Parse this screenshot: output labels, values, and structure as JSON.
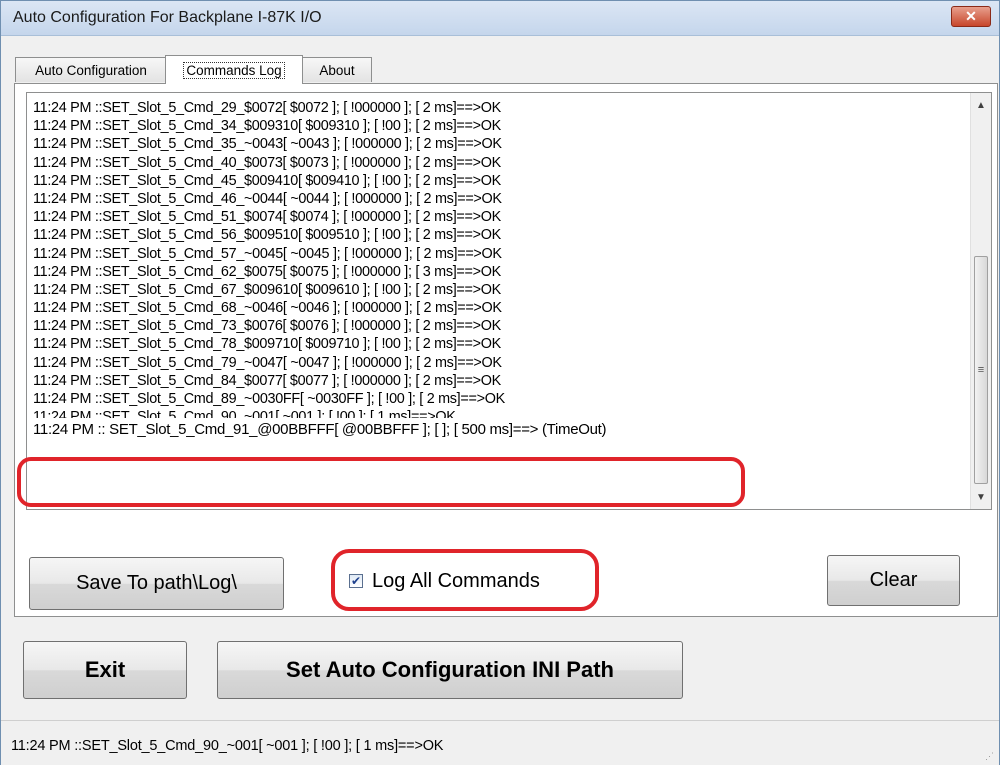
{
  "window": {
    "title": "Auto Configuration For Backplane I-87K I/O",
    "close_label": "✕"
  },
  "tabs": [
    {
      "label": "Auto Configuration",
      "active": false
    },
    {
      "label": "Commands Log",
      "active": true
    },
    {
      "label": "About",
      "active": false
    }
  ],
  "log": {
    "lines": [
      "11:24 PM ::SET_Slot_5_Cmd_29_$0072[ $0072 ]; [ !000000 ]; [ 2 ms]==>OK",
      "11:24 PM ::SET_Slot_5_Cmd_34_$009310[ $009310 ]; [ !00 ]; [ 2 ms]==>OK",
      "11:24 PM ::SET_Slot_5_Cmd_35_~0043[ ~0043 ]; [ !000000 ]; [ 2 ms]==>OK",
      "11:24 PM ::SET_Slot_5_Cmd_40_$0073[ $0073 ]; [ !000000 ]; [ 2 ms]==>OK",
      "11:24 PM ::SET_Slot_5_Cmd_45_$009410[ $009410 ]; [ !00 ]; [ 2 ms]==>OK",
      "11:24 PM ::SET_Slot_5_Cmd_46_~0044[ ~0044 ]; [ !000000 ]; [ 2 ms]==>OK",
      "11:24 PM ::SET_Slot_5_Cmd_51_$0074[ $0074 ]; [ !000000 ]; [ 2 ms]==>OK",
      "11:24 PM ::SET_Slot_5_Cmd_56_$009510[ $009510 ]; [ !00 ]; [ 2 ms]==>OK",
      "11:24 PM ::SET_Slot_5_Cmd_57_~0045[ ~0045 ]; [ !000000 ]; [ 2 ms]==>OK",
      "11:24 PM ::SET_Slot_5_Cmd_62_$0075[ $0075 ]; [ !000000 ]; [ 3 ms]==>OK",
      "11:24 PM ::SET_Slot_5_Cmd_67_$009610[ $009610 ]; [ !00 ]; [ 2 ms]==>OK",
      "11:24 PM ::SET_Slot_5_Cmd_68_~0046[ ~0046 ]; [ !000000 ]; [ 2 ms]==>OK",
      "11:24 PM ::SET_Slot_5_Cmd_73_$0076[ $0076 ]; [ !000000 ]; [ 2 ms]==>OK",
      "11:24 PM ::SET_Slot_5_Cmd_78_$009710[ $009710 ]; [ !00 ]; [ 2 ms]==>OK",
      "11:24 PM ::SET_Slot_5_Cmd_79_~0047[ ~0047 ]; [ !000000 ]; [ 2 ms]==>OK",
      "11:24 PM ::SET_Slot_5_Cmd_84_$0077[ $0077 ]; [ !000000 ]; [ 2 ms]==>OK",
      "11:24 PM ::SET_Slot_5_Cmd_89_~0030FF[ ~0030FF ]; [ !00 ]; [ 2 ms]==>OK",
      "11:24 PM ::SET_Slot_5_Cmd_90_~001[ ~001 ]; [ !00 ]; [ 1 ms]==>OK"
    ],
    "highlighted_line": "11:24 PM :: SET_Slot_5_Cmd_91_@00BBFFF[ @00BBFFF ]; [  ]; [ 500 ms]==> (TimeOut)"
  },
  "buttons": {
    "save": "Save To path\\Log\\",
    "clear": "Clear",
    "exit": "Exit",
    "set_ini": "Set Auto Configuration INI Path"
  },
  "log_all_commands": {
    "label": "Log All Commands",
    "checked": true
  },
  "status": {
    "text": "11:24 PM ::SET_Slot_5_Cmd_90_~001[ ~001 ]; [ !00 ]; [ 1 ms]==>OK"
  },
  "colors": {
    "annotation": "#e0242a",
    "titlebar": "#c5d6ec"
  }
}
